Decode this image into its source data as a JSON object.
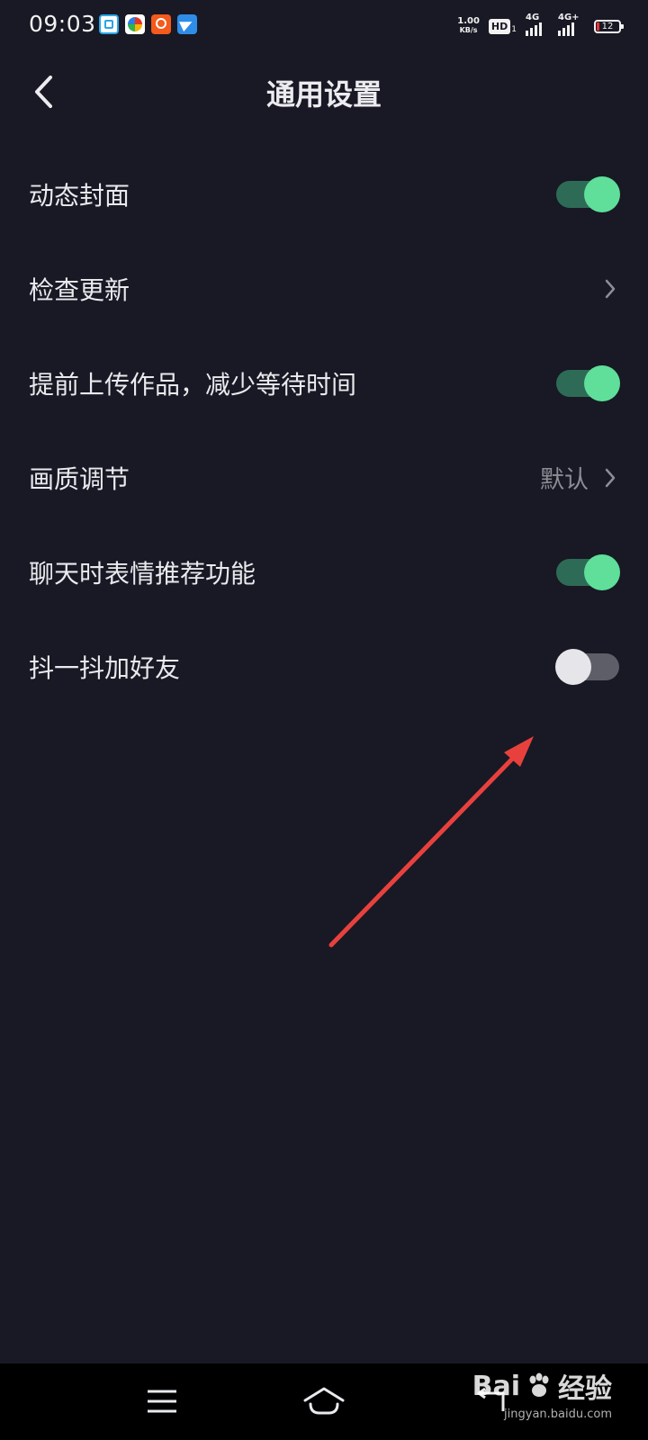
{
  "status_bar": {
    "time": "09:03",
    "net_speed_value": "1.00",
    "net_speed_unit": "KB/s",
    "hd_label": "HD",
    "hd_sub": "1",
    "sim1_label": "4G",
    "sim2_label": "4G+",
    "battery_level": "12"
  },
  "header": {
    "title": "通用设置",
    "back_icon": "chevron-left-icon"
  },
  "settings": [
    {
      "label": "动态封面",
      "control": "toggle",
      "on": true
    },
    {
      "label": "检查更新",
      "control": "chevron"
    },
    {
      "label": "提前上传作品，减少等待时间",
      "control": "toggle",
      "on": true
    },
    {
      "label": "画质调节",
      "control": "chevron",
      "value": "默认"
    },
    {
      "label": "聊天时表情推荐功能",
      "control": "toggle",
      "on": true
    },
    {
      "label": "抖一抖加好友",
      "control": "toggle",
      "on": false
    }
  ],
  "colors": {
    "background": "#181924",
    "toggle_on_track": "#2e6b56",
    "toggle_on_knob": "#5fdf9a",
    "toggle_off_track": "#5d5e67",
    "toggle_off_knob": "#e6e6ea",
    "annotation_arrow": "#e8413d"
  },
  "nav_bar": {
    "menu_icon": "menu-icon",
    "home_icon": "home-icon",
    "back_icon": "back-icon"
  },
  "watermark": {
    "brand": "Bai",
    "brand_suffix": "经验",
    "url": "jingyan.baidu.com"
  }
}
